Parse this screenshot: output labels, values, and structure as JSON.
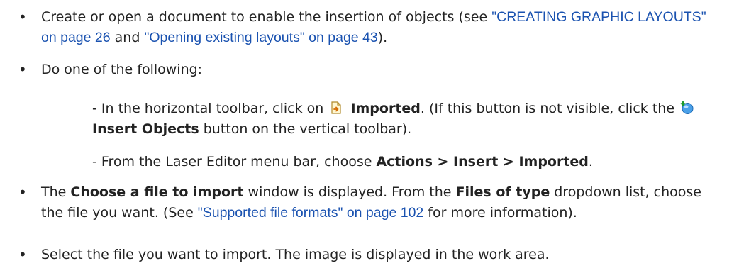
{
  "bullet_char": "•",
  "items": [
    {
      "pre": "Create or open a document to enable the insertion of objects (see ",
      "link1": "\"CREATING GRAPHIC LAYOUTS\" on page 26",
      "mid": " and ",
      "link2": "\"Opening existing layouts\" on page 43",
      "post": ")."
    },
    {
      "text": "Do one of the following:"
    },
    {
      "pre": "The ",
      "bold1": "Choose a file to import",
      "mid1": " window is displayed. From the ",
      "bold2": "Files of type",
      "mid2": " dropdown list, choose the file you want. (See ",
      "link": "\"Supported file formats\" on page 102",
      "post": " for more information)."
    },
    {
      "text": "Select the file you want to import. The image is displayed in the work area."
    }
  ],
  "sub1": {
    "pre": "- In the horizontal toolbar, click on ",
    "bold1": "Imported",
    "mid": ". (If this button is not visible, click the ",
    "bold2": "Insert Objects",
    "post": " button on the vertical toolbar).",
    "icon1": "imported-icon",
    "icon2": "insert-objects-icon"
  },
  "sub2": {
    "pre": "- From the Laser Editor menu bar, choose ",
    "bold": "Actions > Insert > Imported",
    "post": "."
  }
}
